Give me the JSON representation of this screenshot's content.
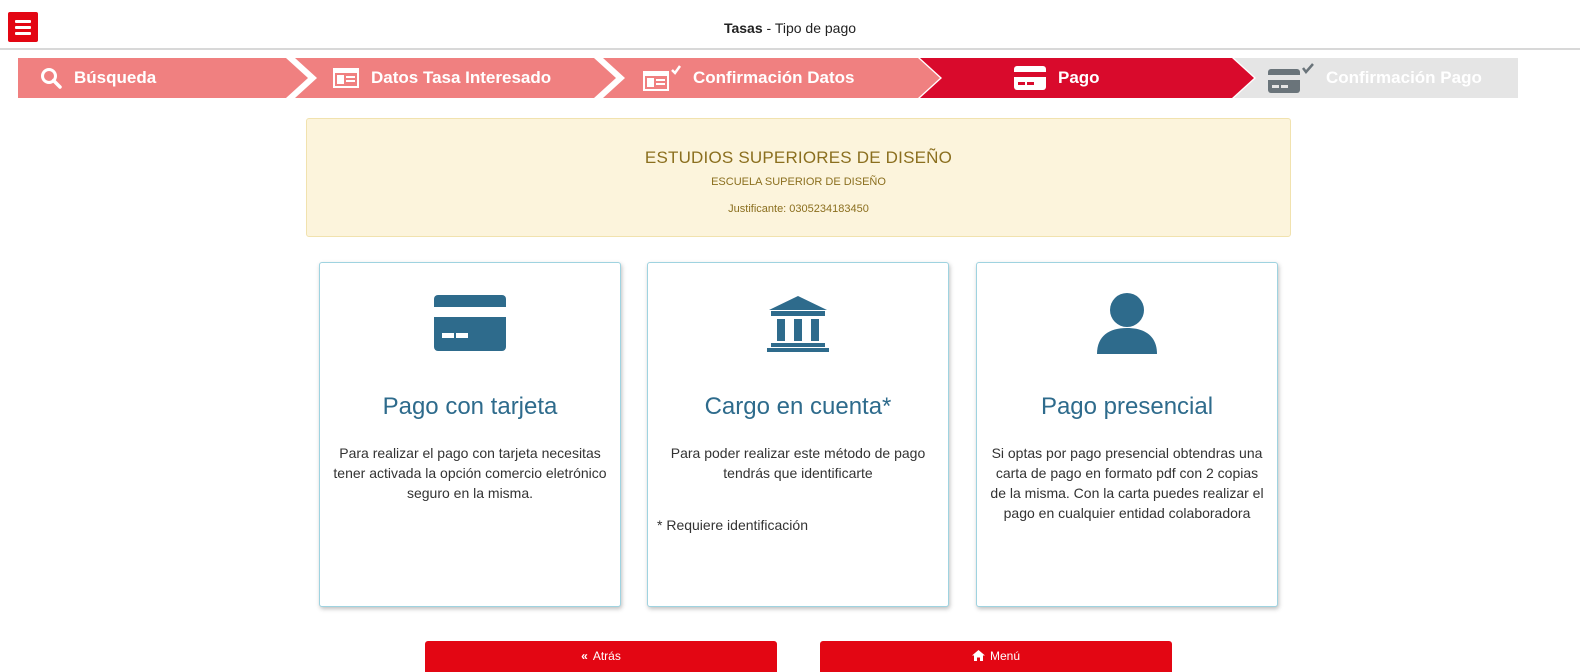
{
  "header": {
    "title_bold": "Tasas",
    "title_rest": " - Tipo de pago"
  },
  "stepper": [
    {
      "label": "Búsqueda",
      "icon": "search-icon",
      "state": "completed"
    },
    {
      "label": "Datos Tasa Interesado",
      "icon": "id-card-icon",
      "state": "completed"
    },
    {
      "label": "Confirmación Datos",
      "icon": "id-card-check-icon",
      "state": "completed"
    },
    {
      "label": "Pago",
      "icon": "credit-card-icon",
      "state": "active"
    },
    {
      "label": "Confirmación Pago",
      "icon": "credit-card-check-icon",
      "state": "pending"
    }
  ],
  "info": {
    "title": "ESTUDIOS SUPERIORES DE DISEÑO",
    "subtitle": "ESCUELA SUPERIOR DE DISEÑO",
    "justificante": "Justificante: 0305234183450"
  },
  "cards": [
    {
      "icon": "credit-card-icon",
      "title": "Pago con tarjeta",
      "text": "Para realizar el pago con tarjeta necesitas tener activada la opción comercio eletrónico seguro en la misma.",
      "note": ""
    },
    {
      "icon": "bank-icon",
      "title": "Cargo en cuenta*",
      "text": "Para poder realizar este método de pago tendrás que identificarte",
      "note": "* Requiere identificación"
    },
    {
      "icon": "user-icon",
      "title": "Pago presencial",
      "text": "Si optas por pago presencial obtendras una carta de pago en formato pdf con 2 copias de la misma. Con la carta puedes realizar el pago en cualquier entidad colaboradora",
      "note": ""
    }
  ],
  "buttons": {
    "back_label": "Atrás",
    "menu_label": "Menú"
  },
  "colors": {
    "brand_red": "#e30613",
    "completed_step": "#f08080",
    "pending_step": "#e5e5e5",
    "card_icon": "#2e6b8c",
    "info_bg": "#fcf4dc"
  }
}
